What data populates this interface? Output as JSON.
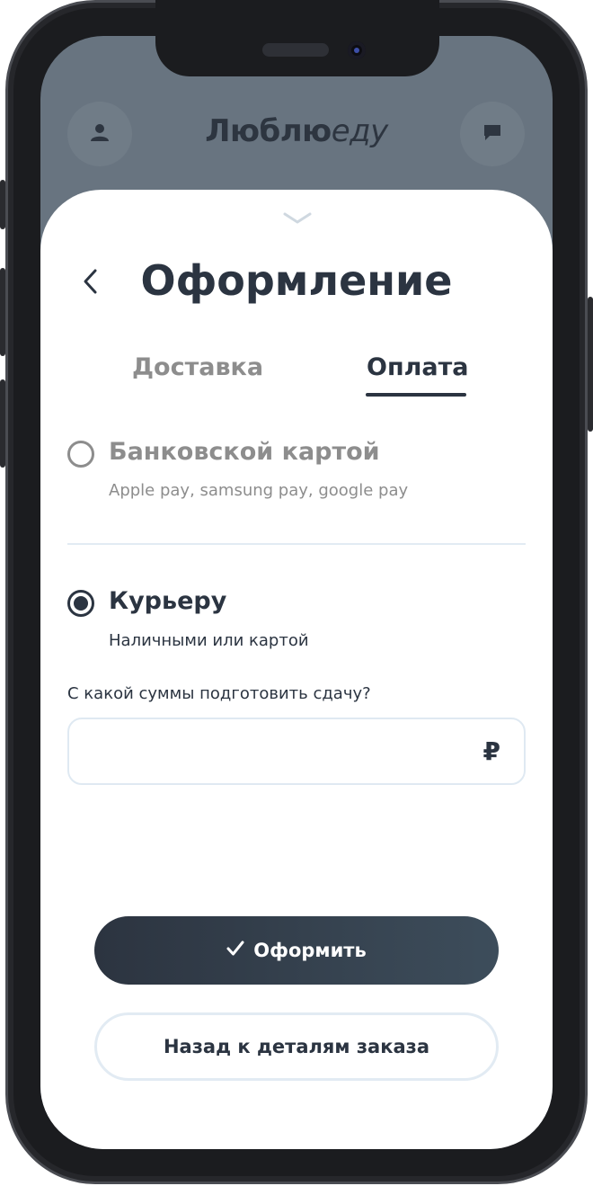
{
  "header": {
    "brand_bold": "Люблю",
    "brand_light": "еду",
    "profile_icon": "user-icon",
    "chat_icon": "chat-icon"
  },
  "sheet": {
    "title": "Оформление",
    "back_icon": "chevron-left-icon",
    "grabber_icon": "chevron-down-icon",
    "tabs": [
      {
        "label": "Доставка",
        "active": false
      },
      {
        "label": "Оплата",
        "active": true
      }
    ],
    "payment_options": [
      {
        "title": "Банковской картой",
        "subtitle": "Apple pay, samsung pay, google pay",
        "selected": false
      },
      {
        "title": "Курьеру",
        "subtitle": "Наличными или картой",
        "selected": true
      }
    ],
    "change_question": "С какой суммы подготовить сдачу?",
    "change_input": {
      "value": "",
      "placeholder": "",
      "currency": "₽"
    },
    "submit_label": "Оформить",
    "submit_icon": "check-icon",
    "back_to_order_label": "Назад к деталям заказа"
  },
  "colors": {
    "accent": "#2b3441",
    "muted": "#8d8d8d",
    "divider": "#e2ebf3",
    "backdrop": "#687480"
  }
}
